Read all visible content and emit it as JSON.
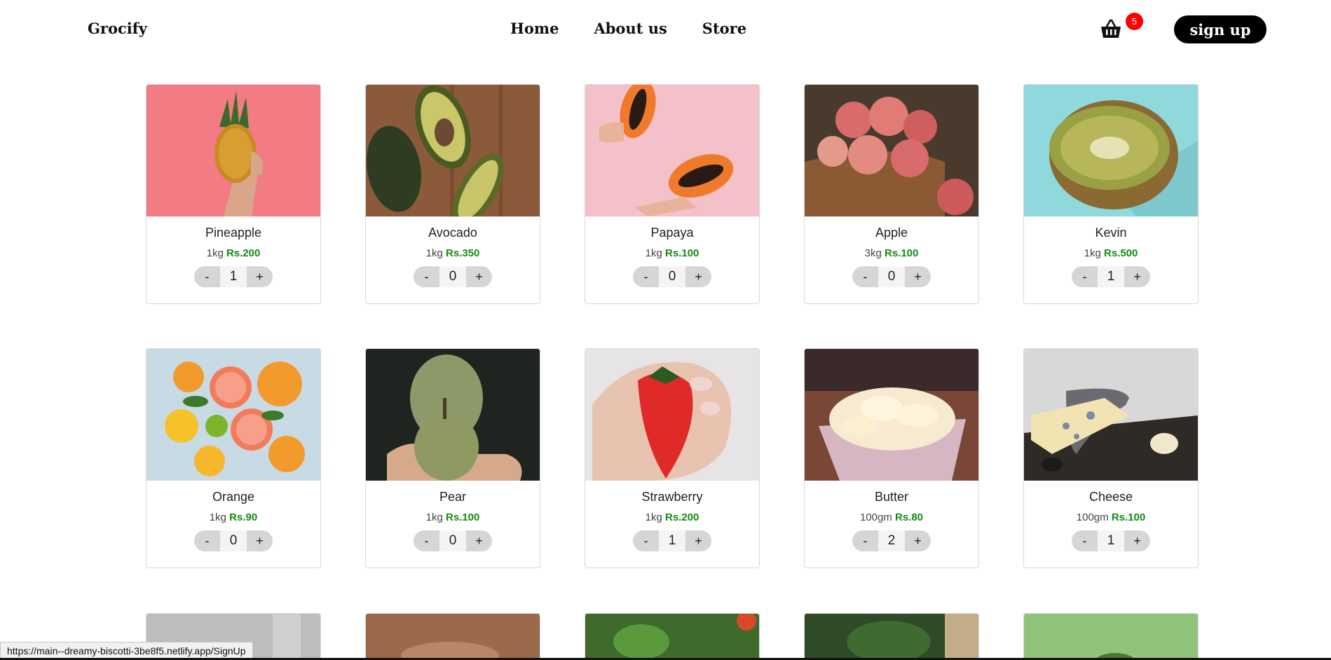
{
  "brand": "Grocify",
  "nav": {
    "links": [
      "Home",
      "About us",
      "Store"
    ]
  },
  "cart": {
    "icon": "basket-icon",
    "count": "5"
  },
  "signup_label": "sign up",
  "products": [
    {
      "name": "Pineapple",
      "unit": "1kg",
      "price": "Rs.200",
      "qty": "1",
      "image": "pineapple-image"
    },
    {
      "name": "Avocado",
      "unit": "1kg",
      "price": "Rs.350",
      "qty": "0",
      "image": "avocado-image"
    },
    {
      "name": "Papaya",
      "unit": "1kg",
      "price": "Rs.100",
      "qty": "0",
      "image": "papaya-image"
    },
    {
      "name": "Apple",
      "unit": "3kg",
      "price": "Rs.100",
      "qty": "0",
      "image": "apple-image"
    },
    {
      "name": "Kevin",
      "unit": "1kg",
      "price": "Rs.500",
      "qty": "1",
      "image": "kiwi-image"
    },
    {
      "name": "Orange",
      "unit": "1kg",
      "price": "Rs.90",
      "qty": "0",
      "image": "orange-image"
    },
    {
      "name": "Pear",
      "unit": "1kg",
      "price": "Rs.100",
      "qty": "0",
      "image": "pear-image"
    },
    {
      "name": "Strawberry",
      "unit": "1kg",
      "price": "Rs.200",
      "qty": "1",
      "image": "strawberry-image"
    },
    {
      "name": "Butter",
      "unit": "100gm",
      "price": "Rs.80",
      "qty": "2",
      "image": "butter-image"
    },
    {
      "name": "Cheese",
      "unit": "100gm",
      "price": "Rs.100",
      "qty": "1",
      "image": "cheese-image"
    }
  ],
  "qty_controls": {
    "minus": "-",
    "plus": "+"
  },
  "status_url": "https://main--dreamy-biscotti-3be8f5.netlify.app/SignUp",
  "colors": {
    "price": "#138a13",
    "badge": "#ff0000",
    "button": "#000000"
  }
}
